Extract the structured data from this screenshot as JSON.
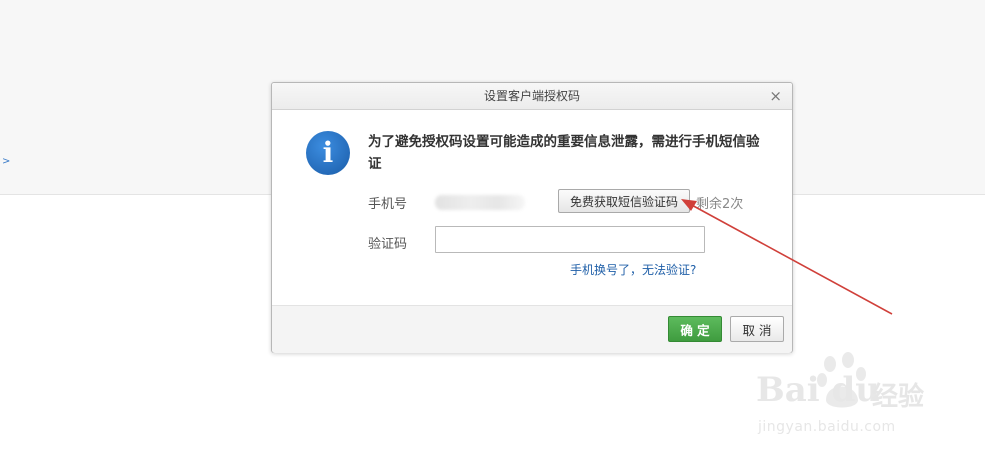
{
  "page": {
    "edge_glyph": ">"
  },
  "dialog": {
    "title": "设置客户端授权码",
    "close_glyph": "×",
    "info_icon_glyph": "i",
    "message": "为了避免授权码设置可能造成的重要信息泄露，需进行手机短信验证",
    "phone_label": "手机号",
    "sms_button_label": "免费获取短信验证码",
    "remaining_text": "剩余2次",
    "code_label": "验证码",
    "code_value": "",
    "help_link_text": "手机换号了，无法验证?",
    "ok_button_label": "确 定",
    "cancel_button_label": "取 消"
  },
  "watermark": {
    "brand": "Bai du",
    "product": "经验",
    "url": "jingyan.baidu.com"
  },
  "colors": {
    "primary_button": "#3f9c3f",
    "link": "#1f5fa8",
    "info_icon": "#1a5ca8",
    "annotation_arrow": "#d0403a"
  },
  "icons": {
    "close": "close-icon",
    "info": "info-icon",
    "annotation": "red-arrow-annotation"
  }
}
